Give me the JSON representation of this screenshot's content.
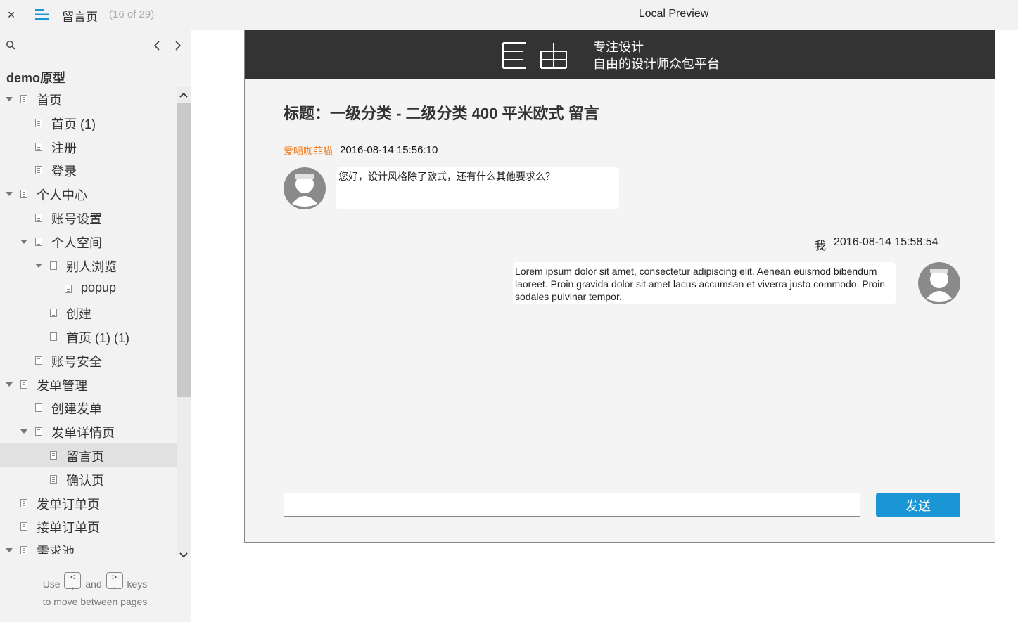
{
  "topbar": {
    "close_icon": "×",
    "page_name": "留言页",
    "page_count": "(16 of 29)",
    "preview_title": "Local Preview"
  },
  "sidebar": {
    "project_name": "demo原型",
    "items": [
      {
        "label": "首页",
        "level": 0,
        "expanded": true
      },
      {
        "label": "首页 (1)",
        "level": 1
      },
      {
        "label": "注册",
        "level": 1
      },
      {
        "label": "登录",
        "level": 1
      },
      {
        "label": "个人中心",
        "level": 0,
        "expanded": true
      },
      {
        "label": "账号设置",
        "level": 1
      },
      {
        "label": "个人空间",
        "level": 1,
        "expanded": true
      },
      {
        "label": "别人浏览",
        "level": 2,
        "expanded": true
      },
      {
        "label": "popup",
        "level": 3
      },
      {
        "label": "创建",
        "level": 2
      },
      {
        "label": "首页 (1) (1)",
        "level": 2
      },
      {
        "label": "账号安全",
        "level": 1
      },
      {
        "label": "发单管理",
        "level": 0,
        "expanded": true
      },
      {
        "label": "创建发单",
        "level": 1
      },
      {
        "label": "发单详情页",
        "level": 1,
        "expanded": true
      },
      {
        "label": "留言页",
        "level": 2,
        "selected": true
      },
      {
        "label": "确认页",
        "level": 2
      },
      {
        "label": "发单订单页",
        "level": 0
      },
      {
        "label": "接单订单页",
        "level": 0
      },
      {
        "label": "需求池",
        "level": 0,
        "expanded": true
      }
    ],
    "help": {
      "use": "Use",
      "key_prev": "<\n,",
      "and": "and",
      "key_next": ">\n.",
      "keys": "keys",
      "line2": "to move between pages"
    }
  },
  "proto": {
    "header": {
      "slogan_line1": "专注设计",
      "slogan_line2": "自由的设计师众包平台"
    },
    "title": "标题：一级分类 - 二级分类 400 平米欧式 留言",
    "message1": {
      "user": "爱喝咖菲猫",
      "time": "2016-08-14 15:56:10",
      "text": "您好，设计风格除了欧式，还有什么其他要求么？"
    },
    "message2": {
      "user": "我",
      "time": "2016-08-14 15:58:54",
      "text": "Lorem ipsum dolor sit amet, consectetur adipiscing elit. Aenean euismod bibendum laoreet. Proin gravida dolor sit amet lacus accumsan et viverra justo commodo. Proin sodales pulvinar tempor."
    },
    "reply_value": "",
    "send_label": "发送"
  },
  "colors": {
    "header_bg": "#333333",
    "username": "#f27d1f",
    "send_button": "#1a96d4",
    "menu_icon": "#1a96d4"
  }
}
